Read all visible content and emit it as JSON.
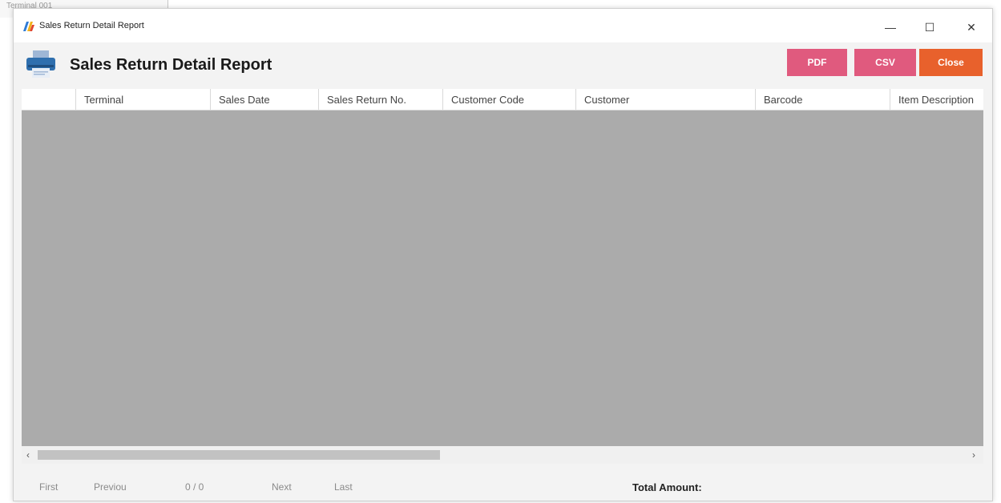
{
  "window": {
    "title": "Sales Return Detail Report",
    "controls": {
      "minimize": "—",
      "maximize": "☐",
      "close": "✕"
    }
  },
  "background_window": {
    "fragment": "Terminal 001"
  },
  "header": {
    "title": "Sales Return Detail Report",
    "icon": "printer-icon",
    "buttons": {
      "pdf": "PDF",
      "csv": "CSV",
      "close": "Close"
    }
  },
  "grid": {
    "columns": [
      "",
      "Terminal",
      "Sales Date",
      "Sales Return No.",
      "Customer Code",
      "Customer",
      "Barcode",
      "Item Description"
    ],
    "rows": []
  },
  "pager": {
    "first": "First",
    "previous": "Previou",
    "page_status": "0 / 0",
    "next": "Next",
    "last": "Last"
  },
  "totals": {
    "label": "Total Amount:"
  },
  "colors": {
    "pdf_button": "#e05a7e",
    "csv_button": "#e05a7e",
    "close_button": "#e8612c",
    "grid_background": "#ababab"
  }
}
